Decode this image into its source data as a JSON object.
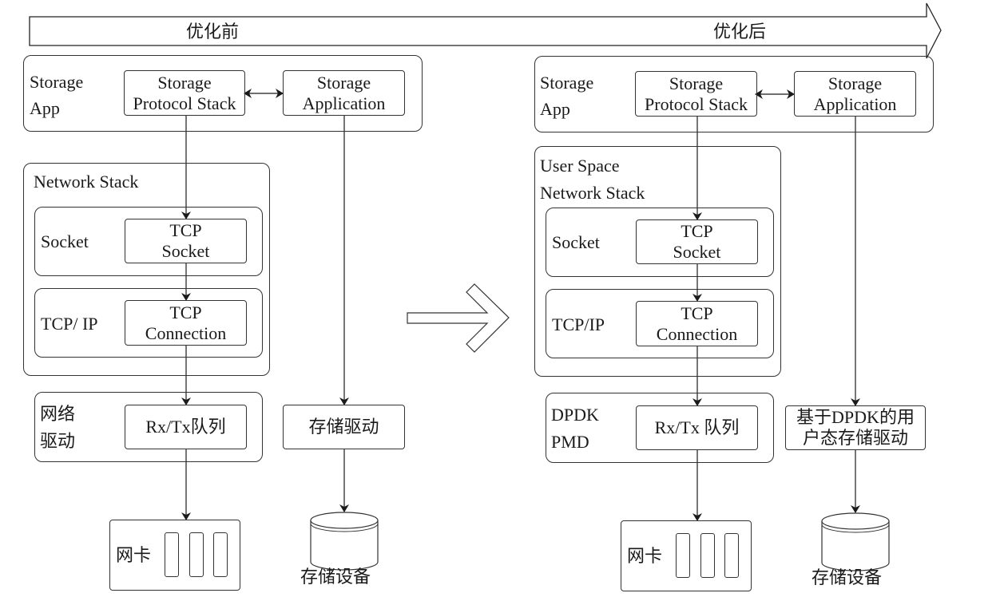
{
  "banner": {
    "before_label": "优化前",
    "after_label": "优化后"
  },
  "before": {
    "storage_app": {
      "label": "Storage\nApp",
      "protocol_stack": "Storage\nProtocol Stack",
      "application": "Storage\nApplication"
    },
    "network_stack": {
      "label": "Network Stack",
      "socket_layer": {
        "label": "Socket",
        "inner": "TCP\nSocket"
      },
      "tcpip_layer": {
        "label": "TCP/ IP",
        "inner": "TCP\nConnection"
      }
    },
    "driver": {
      "label": "网络\n驱动",
      "inner": "Rx/Tx队列"
    },
    "storage_driver": "存储驱动",
    "nic": {
      "label": "网卡"
    },
    "storage_device": "存储设备"
  },
  "after": {
    "storage_app": {
      "label": "Storage\nApp",
      "protocol_stack": "Storage\nProtocol Stack",
      "application": "Storage\nApplication"
    },
    "network_stack": {
      "label": "User Space\nNetwork Stack",
      "socket_layer": {
        "label": "Socket",
        "inner": "TCP\nSocket"
      },
      "tcpip_layer": {
        "label": "TCP/IP",
        "inner": "TCP\nConnection"
      }
    },
    "driver": {
      "label": "DPDK\nPMD",
      "inner": "Rx/Tx 队列"
    },
    "storage_driver": "基于DPDK的用\n户态存储驱动",
    "nic": {
      "label": "网卡"
    },
    "storage_device": "存储设备"
  }
}
